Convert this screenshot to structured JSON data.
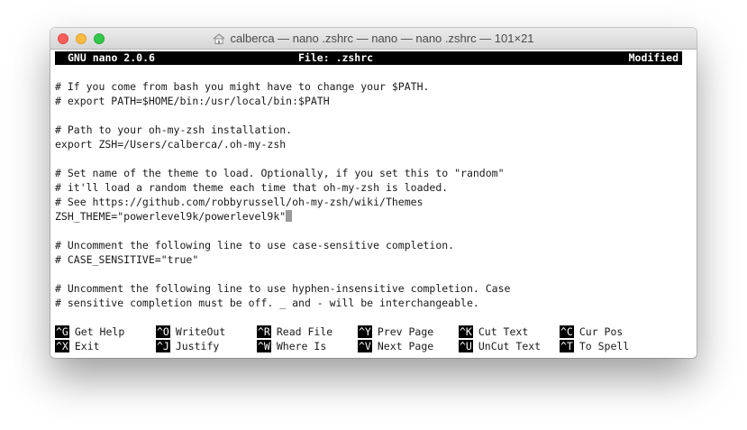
{
  "window": {
    "title": "calberca — nano .zshrc — nano — nano .zshrc — 101×21"
  },
  "header": {
    "version": "GNU nano 2.0.6",
    "file": "File: .zshrc",
    "status": "Modified"
  },
  "lines": [
    "# If you come from bash you might have to change your $PATH.",
    "# export PATH=$HOME/bin:/usr/local/bin:$PATH",
    "# Path to your oh-my-zsh installation.",
    "export ZSH=/Users/calberca/.oh-my-zsh",
    "# Set name of the theme to load. Optionally, if you set this to \"random\"",
    "# it'll load a random theme each time that oh-my-zsh is loaded.",
    "# See https://github.com/robbyrussell/oh-my-zsh/wiki/Themes",
    "ZSH_THEME=\"powerlevel9k/powerlevel9k\"",
    "# Uncomment the following line to use case-sensitive completion.",
    "# CASE_SENSITIVE=\"true\"",
    "# Uncomment the following line to use hyphen-insensitive completion. Case",
    "# sensitive completion must be off. _ and - will be interchangeable."
  ],
  "shortcuts": {
    "get_help": {
      "key": "^G",
      "label": "Get Help"
    },
    "write_out": {
      "key": "^O",
      "label": "WriteOut"
    },
    "read_file": {
      "key": "^R",
      "label": "Read File"
    },
    "prev_page": {
      "key": "^Y",
      "label": "Prev Page"
    },
    "cut_text": {
      "key": "^K",
      "label": "Cut Text"
    },
    "cur_pos": {
      "key": "^C",
      "label": "Cur Pos"
    },
    "exit": {
      "key": "^X",
      "label": "Exit"
    },
    "justify": {
      "key": "^J",
      "label": "Justify"
    },
    "where_is": {
      "key": "^W",
      "label": "Where Is"
    },
    "next_page": {
      "key": "^V",
      "label": "Next Page"
    },
    "uncut_text": {
      "key": "^U",
      "label": "UnCut Text"
    },
    "to_spell": {
      "key": "^T",
      "label": "To Spell"
    }
  },
  "icons": {
    "title_icon": "home-folder-icon"
  },
  "colors": {
    "close": "#fc605c",
    "minimize": "#fdbc40",
    "zoom": "#34c84a",
    "header_bg": "#000000",
    "header_fg": "#ffffff",
    "cursor": "#9a9a9a"
  }
}
